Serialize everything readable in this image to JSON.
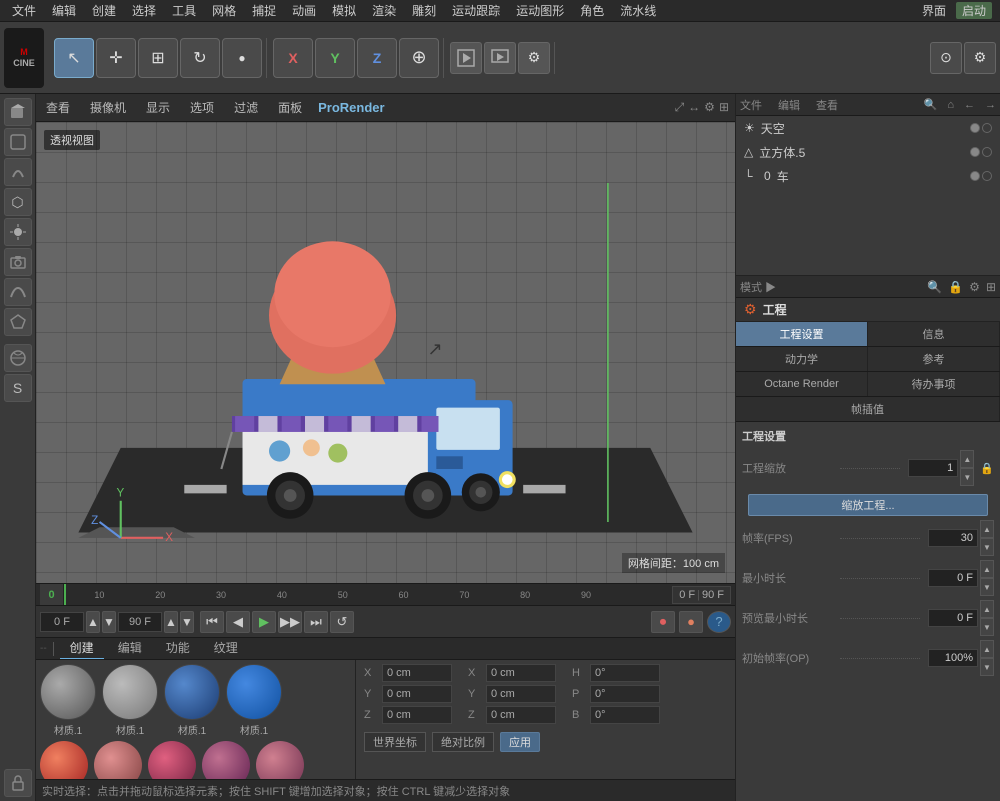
{
  "app": {
    "title": "Cinema 4D"
  },
  "topmenu": {
    "items": [
      "文件",
      "编辑",
      "创建",
      "选择",
      "工具",
      "网格",
      "捕捉",
      "动画",
      "模拟",
      "渲染",
      "雕刻",
      "运动跟踪",
      "运动图形",
      "角色",
      "流水线"
    ],
    "right": [
      "界面",
      "启动"
    ]
  },
  "toolbar": {
    "groups": [
      {
        "buttons": [
          "↖",
          "✛",
          "⊞",
          "↻",
          "⊕"
        ]
      },
      {
        "buttons": [
          "X",
          "Y",
          "Z",
          "⊕"
        ]
      },
      {
        "buttons": [
          "▶▶",
          "▶|",
          "⚙"
        ]
      }
    ]
  },
  "viewport": {
    "label": "透视视图",
    "grid_info": "网格间距：100 cm",
    "prorender": "ProRender"
  },
  "viewport_toolbar": {
    "items": [
      "查看",
      "摄像机",
      "显示",
      "选项",
      "过滤",
      "面板"
    ],
    "right_icons": [
      "⤢",
      "↔",
      "⚙",
      "⊞"
    ]
  },
  "timeline": {
    "markers": [
      "0",
      "10",
      "20",
      "30",
      "40",
      "50",
      "60",
      "70",
      "80",
      "90"
    ],
    "current_frame": "0 F",
    "end_frame": "90 F"
  },
  "transport": {
    "frame_start": "0 F",
    "frame_end": "90 F",
    "buttons": [
      "⏮",
      "◀",
      "▶",
      "▶▶",
      "⏭",
      "↺"
    ]
  },
  "bottom_tabs": {
    "items": [
      "创建",
      "编辑",
      "功能",
      "纹理"
    ]
  },
  "materials": {
    "items": [
      {
        "label": "材质.1",
        "color": "#707070"
      },
      {
        "label": "材质.1",
        "color": "#909090"
      },
      {
        "label": "材质.1",
        "color": "#3060a0"
      },
      {
        "label": "材质.1",
        "color": "#2060c0"
      }
    ],
    "row2": [
      {
        "color": "#e05030"
      },
      {
        "color": "#c08080"
      },
      {
        "color": "#d04060"
      },
      {
        "color": "#b06080"
      },
      {
        "color": "#c06070"
      }
    ]
  },
  "coords": {
    "x_pos": "0 cm",
    "y_pos": "0 cm",
    "z_pos": "0 cm",
    "x_size": "0 cm",
    "y_size": "0 cm",
    "z_size": "0 cm",
    "h": "0°",
    "p": "0°",
    "b": "0°",
    "mode_world": "世界坐标",
    "mode_abs": "绝对比例",
    "apply": "应用",
    "labels": {
      "x": "X",
      "y": "Y",
      "z": "Z",
      "x2": "X",
      "y2": "Y",
      "z2": "Z",
      "h": "H",
      "p": "P",
      "b": "B"
    }
  },
  "status_bar": {
    "text": "实时选择：点击并拖动鼠标选择元素；按住 SHIFT 键增加选择对象；按住 CTRL 键减少选择对象"
  },
  "object_list": {
    "toolbar_label": "模式 ▶",
    "items": [
      {
        "icon": "☀",
        "name": "天空",
        "selected": false
      },
      {
        "icon": "△",
        "name": "立方体.5",
        "selected": false
      },
      {
        "icon": "🚗",
        "name": "车",
        "selected": false
      }
    ]
  },
  "properties": {
    "toolbar_label": "模式 ▶",
    "title": "工程",
    "title_icon": "⚙",
    "tabs": [
      {
        "label": "工程设置",
        "active": true
      },
      {
        "label": "信息",
        "active": false
      },
      {
        "label": "动力学",
        "active": false
      },
      {
        "label": "参考",
        "active": false
      },
      {
        "label": "Octane Render",
        "active": false
      },
      {
        "label": "待办事项",
        "active": false
      },
      {
        "label": "帧插值",
        "active": false
      }
    ],
    "section_title": "工程设置",
    "fields": [
      {
        "label": "工程缩放",
        "dots": true,
        "value": "1",
        "has_stepper": true
      },
      {
        "label": "帧率(FPS)",
        "dots": true,
        "value": "30",
        "has_stepper": true
      },
      {
        "label": "最小时长",
        "dots": true,
        "value": "0 F",
        "has_stepper": true
      },
      {
        "label": "预览最小时长",
        "dots": true,
        "value": "0 F",
        "has_stepper": true
      },
      {
        "label": "初始帧率(OP)",
        "dots": true,
        "value": "100%",
        "has_stepper": true
      }
    ],
    "scale_btn": "缩放工程..."
  }
}
